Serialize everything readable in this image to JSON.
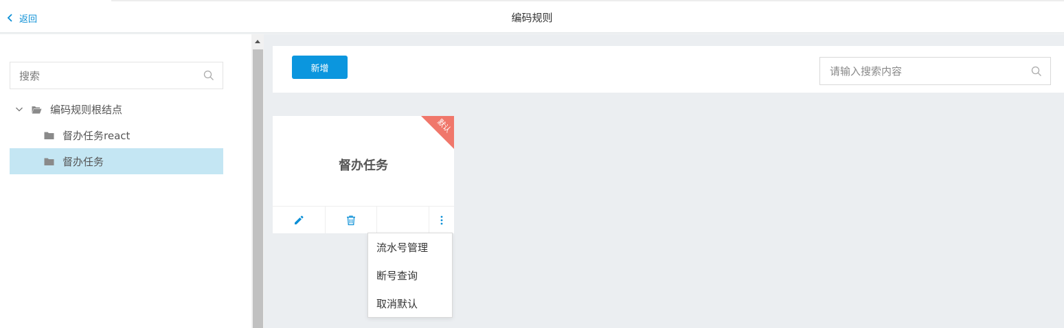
{
  "header": {
    "back_label": "返回",
    "title": "编码规则"
  },
  "sidebar": {
    "search_placeholder": "搜索",
    "tree": {
      "root_label": "编码规则根结点",
      "children": [
        {
          "label": "督办任务react",
          "selected": false
        },
        {
          "label": "督办任务",
          "selected": true
        }
      ]
    }
  },
  "toolbar": {
    "add_label": "新增",
    "search_placeholder": "请输入搜索内容"
  },
  "cards": [
    {
      "title": "督办任务",
      "badge": "默认",
      "actions": [
        "edit-icon",
        "delete-icon",
        "more-icon"
      ]
    }
  ],
  "dropdown": {
    "items": [
      "流水号管理",
      "断号查询",
      "取消默认"
    ]
  },
  "colors": {
    "accent": "#0b96de",
    "link": "#0b8fd6",
    "selected_bg": "#c4e6f3",
    "badge": "#f0776b",
    "page_bg": "#ebeef1"
  }
}
